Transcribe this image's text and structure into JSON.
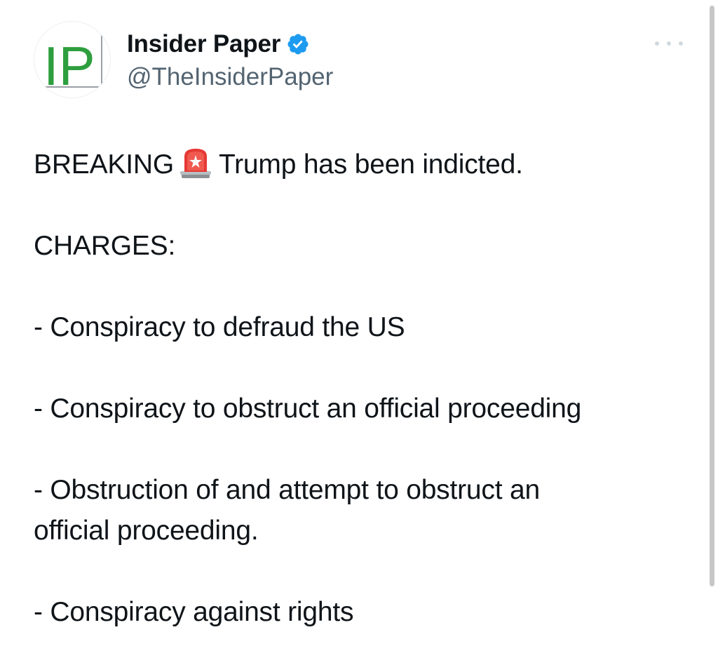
{
  "account": {
    "display_name": "Insider Paper",
    "handle": "@TheInsiderPaper",
    "avatar_text": "IP",
    "verified": true
  },
  "tweet": {
    "lead_word": "BREAKING",
    "lead_emoji": "siren-icon",
    "lead_text": "Trump has been indicted.",
    "charges_header": "CHARGES:",
    "charge_1": "- Conspiracy to defraud the US",
    "charge_2": "- Conspiracy to obstruct an official proceeding",
    "charge_3_line1": "- Obstruction of and attempt to obstruct an",
    "charge_3_line2": "official proceeding.",
    "charge_4": "- Conspiracy against rights"
  },
  "colors": {
    "text": "#0f1419",
    "secondary": "#536471",
    "verified_blue": "#1d9bf0",
    "logo_green": "#2e9e3e"
  },
  "icons": {
    "more": "more-horizontal-icon",
    "verified": "verified-badge-icon"
  }
}
